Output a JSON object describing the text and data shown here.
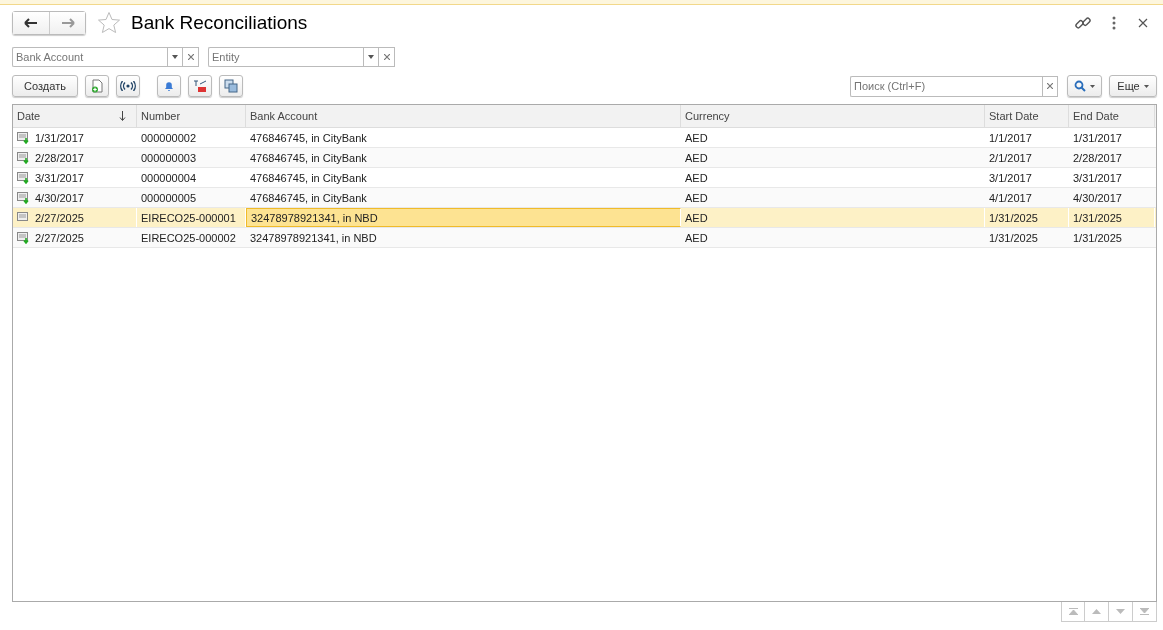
{
  "window": {
    "title": "Bank Reconciliations"
  },
  "filters": [
    {
      "placeholder": "Bank Account"
    },
    {
      "placeholder": "Entity"
    }
  ],
  "toolbar": {
    "create_label": "Создать",
    "search_placeholder": "Поиск (Ctrl+F)",
    "more_label": "Еще"
  },
  "table": {
    "columns": [
      {
        "label": "Date",
        "sorted": true
      },
      {
        "label": "Number",
        "sorted": false
      },
      {
        "label": "Bank Account",
        "sorted": false
      },
      {
        "label": "Currency",
        "sorted": false
      },
      {
        "label": "Start Date",
        "sorted": false
      },
      {
        "label": "End Date",
        "sorted": false
      }
    ],
    "rows": [
      {
        "posted": true,
        "selected": false,
        "cells": [
          "1/31/2017",
          "000000002",
          "476846745, in CityBank",
          "AED",
          "1/1/2017",
          "1/31/2017"
        ]
      },
      {
        "posted": true,
        "selected": false,
        "cells": [
          "2/28/2017",
          "000000003",
          "476846745, in CityBank",
          "AED",
          "2/1/2017",
          "2/28/2017"
        ]
      },
      {
        "posted": true,
        "selected": false,
        "cells": [
          "3/31/2017",
          "000000004",
          "476846745, in CityBank",
          "AED",
          "3/1/2017",
          "3/31/2017"
        ]
      },
      {
        "posted": true,
        "selected": false,
        "cells": [
          "4/30/2017",
          "000000005",
          "476846745, in CityBank",
          "AED",
          "4/1/2017",
          "4/30/2017"
        ]
      },
      {
        "posted": false,
        "selected": true,
        "cells": [
          "2/27/2025",
          "EIRECO25-000001",
          "32478978921341, in NBD",
          "AED",
          "1/31/2025",
          "1/31/2025"
        ]
      },
      {
        "posted": true,
        "selected": false,
        "cells": [
          "2/27/2025",
          "EIRECO25-000002",
          "32478978921341, in NBD",
          "AED",
          "1/31/2025",
          "1/31/2025"
        ]
      }
    ]
  }
}
